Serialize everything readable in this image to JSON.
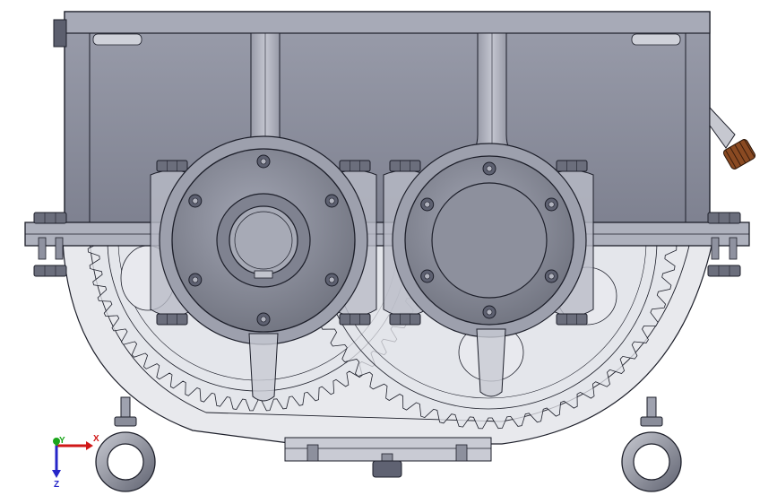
{
  "view": {
    "background_color": "#ffffff",
    "model_body_color": "#8a8d9c",
    "model_dark_color": "#5c5f6e",
    "model_light_color": "#b7b9c5",
    "edge_color": "#1d1f2a",
    "accent_plug_color": "#8a4a22"
  },
  "triad": {
    "x_label": "X",
    "y_label": "Y",
    "z_label": "Z",
    "x_color": "#d01818",
    "y_color": "#1aa51a",
    "z_color": "#2626c8"
  },
  "components": {
    "gears": [
      {
        "name": "large-gear",
        "teeth": 64
      },
      {
        "name": "small-gear",
        "teeth": 60
      }
    ],
    "bearing_bolts_per_cover": 6,
    "flange_bolts": 8,
    "lifting_eyes": 2
  }
}
